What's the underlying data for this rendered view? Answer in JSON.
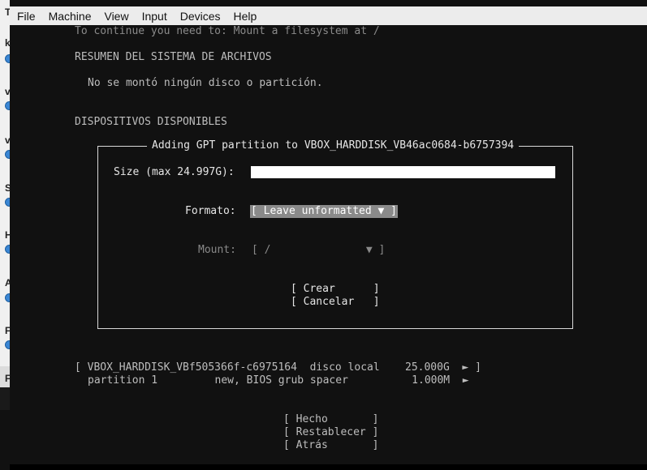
{
  "host": {
    "menubar": [
      "File",
      "Machine",
      "View",
      "Input",
      "Devices",
      "Help"
    ],
    "sidebar_letters": [
      "T",
      "k",
      "v",
      "v",
      "S",
      "H",
      "A",
      "F",
      "F"
    ]
  },
  "installer": {
    "notice": "To continue you need to: Mount a filesystem at /",
    "summary_heading": "RESUMEN DEL SISTEMA DE ARCHIVOS",
    "summary_text": "No se montó ningún disco o partición.",
    "devices_heading": "DISPOSITIVOS DISPONIBLES",
    "disk_row": "[ VBOX_HARDDISK_VBf505366f-c6975164  disco local    25.000G  ► ]",
    "partition_row": "partition 1         new, BIOS grub spacer          1.000M  ►",
    "buttons": {
      "done": "[ Hecho       ]",
      "reset": "[ Restablecer ]",
      "back": "[ Atrás       ]"
    }
  },
  "dialog": {
    "title": "Adding GPT partition to VBOX_HARDDISK_VB46ac0684-b6757394",
    "size_label": "Size (max 24.997G):",
    "size_value": "",
    "format_label": "Formato:",
    "format_value": "[ Leave unformatted ▼ ]",
    "mount_label": "Mount:",
    "mount_value": "[ /               ▼ ]",
    "create_button": "[ Crear      ]",
    "cancel_button": "[ Cancelar   ]"
  }
}
